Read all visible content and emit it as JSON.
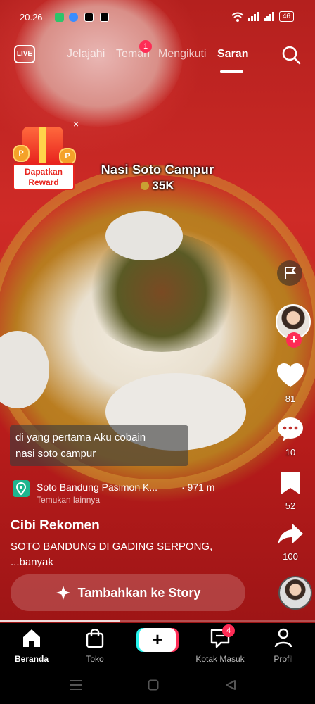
{
  "status_bar": {
    "time": "20.26",
    "battery": "46"
  },
  "top_nav": {
    "live_label": "LIVE",
    "tabs": [
      {
        "label": "Jelajahi"
      },
      {
        "label": "Teman",
        "badge": "1"
      },
      {
        "label": "Mengikuti"
      },
      {
        "label": "Saran",
        "active": true
      }
    ]
  },
  "reward": {
    "line1": "Dapatkan",
    "line2": "Reward",
    "coin_letter": "P",
    "close": "×"
  },
  "video": {
    "title": "Nasi Soto Campur",
    "price": "35K",
    "caption_line1": "di yang pertama Aku cobain",
    "caption_line2": "nasi soto campur"
  },
  "actions": {
    "likes": "81",
    "comments": "10",
    "saves": "52",
    "shares": "100",
    "follow_plus": "+"
  },
  "location": {
    "name": "Soto Bandung Pasimon K...",
    "distance": "· 971 m",
    "more": "Temukan lainnya"
  },
  "post": {
    "author": "Cibi Rekomen",
    "desc_line1": "SOTO BANDUNG DI GADING SERPONG,",
    "desc_line2": "...banyak",
    "story_button": "Tambahkan ke Story"
  },
  "playback": {
    "progress": 0.38
  },
  "tab_bar": {
    "home": "Beranda",
    "shop": "Toko",
    "create": "+",
    "inbox": "Kotak Masuk",
    "inbox_badge": "4",
    "profile": "Profil"
  },
  "colors": {
    "accent": "#fe2c55",
    "cyan": "#25f4ee",
    "location_icon": "#1fb58f"
  }
}
